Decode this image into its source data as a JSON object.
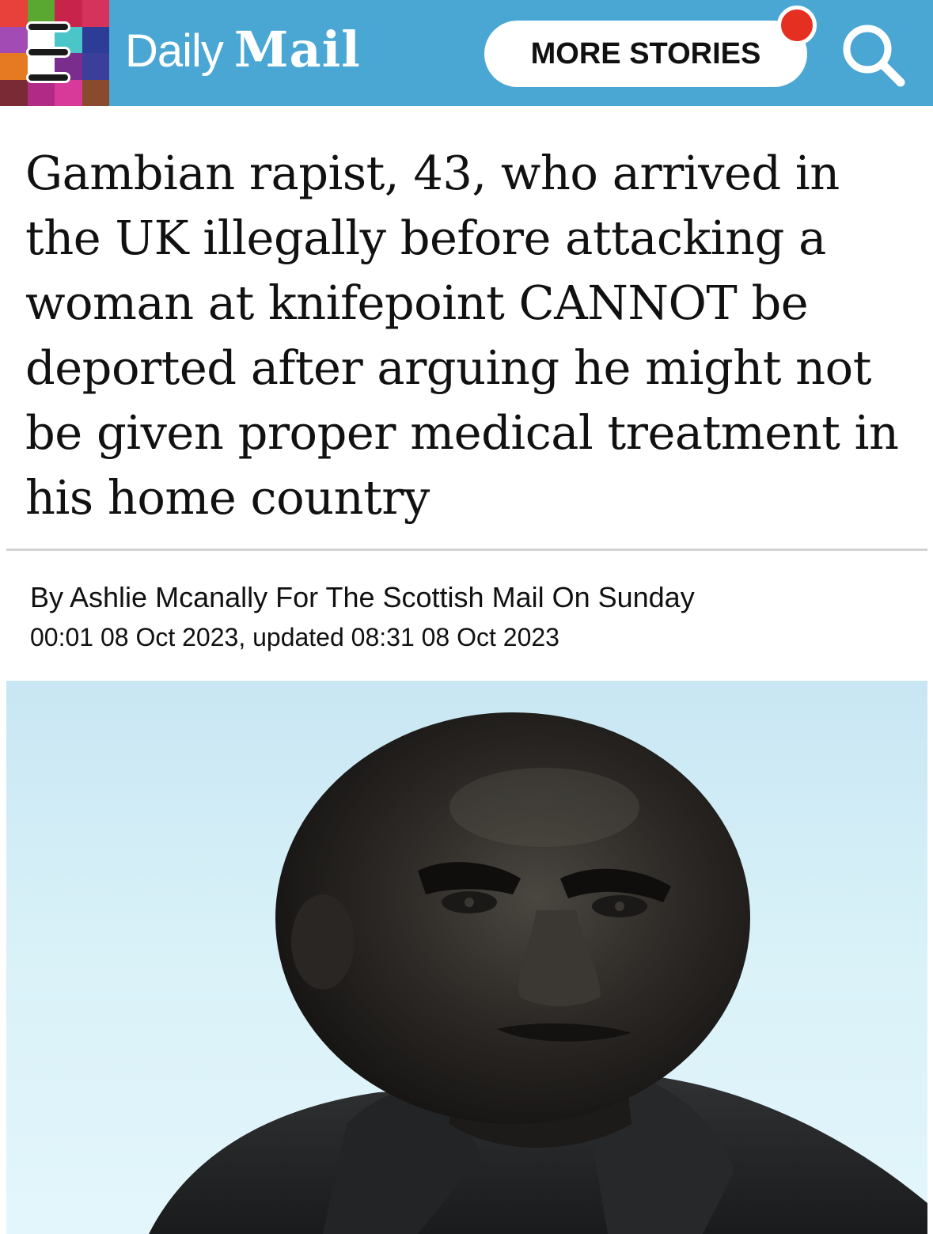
{
  "header": {
    "brand_daily": "Daily",
    "brand_mail": "Mail",
    "more_stories_label": "MORE STORIES",
    "icons": [
      "menu-icon",
      "notification-dot",
      "search-icon"
    ],
    "mosaic_colors": [
      "#e8403a",
      "#5aa832",
      "#c8234a",
      "#d6335c",
      "#a24bb5",
      "#ffffff",
      "#4bc6c8",
      "#2d3c96",
      "#e67a22",
      "#ffffff",
      "#7b2d8e",
      "#3b3f9a",
      "#7a2a35",
      "#b02a86",
      "#d83a9a",
      "#8a4a2e"
    ],
    "bar_color": "#4aa7d4",
    "notification_color": "#e52f21"
  },
  "article": {
    "headline": "Gambian rapist, 43, who arrived in the UK illegally before attacking a woman at knifepoint CANNOT be deported after arguing he might not be given proper medical treatment in his home country",
    "byline": "By Ashlie Mcanally For The Scottish Mail On Sunday",
    "timestamp": "00:01 08 Oct 2023, updated 08:31 08 Oct 2023"
  },
  "image": {
    "subject": "photo of a man",
    "background_color": "#d8f1f8"
  }
}
